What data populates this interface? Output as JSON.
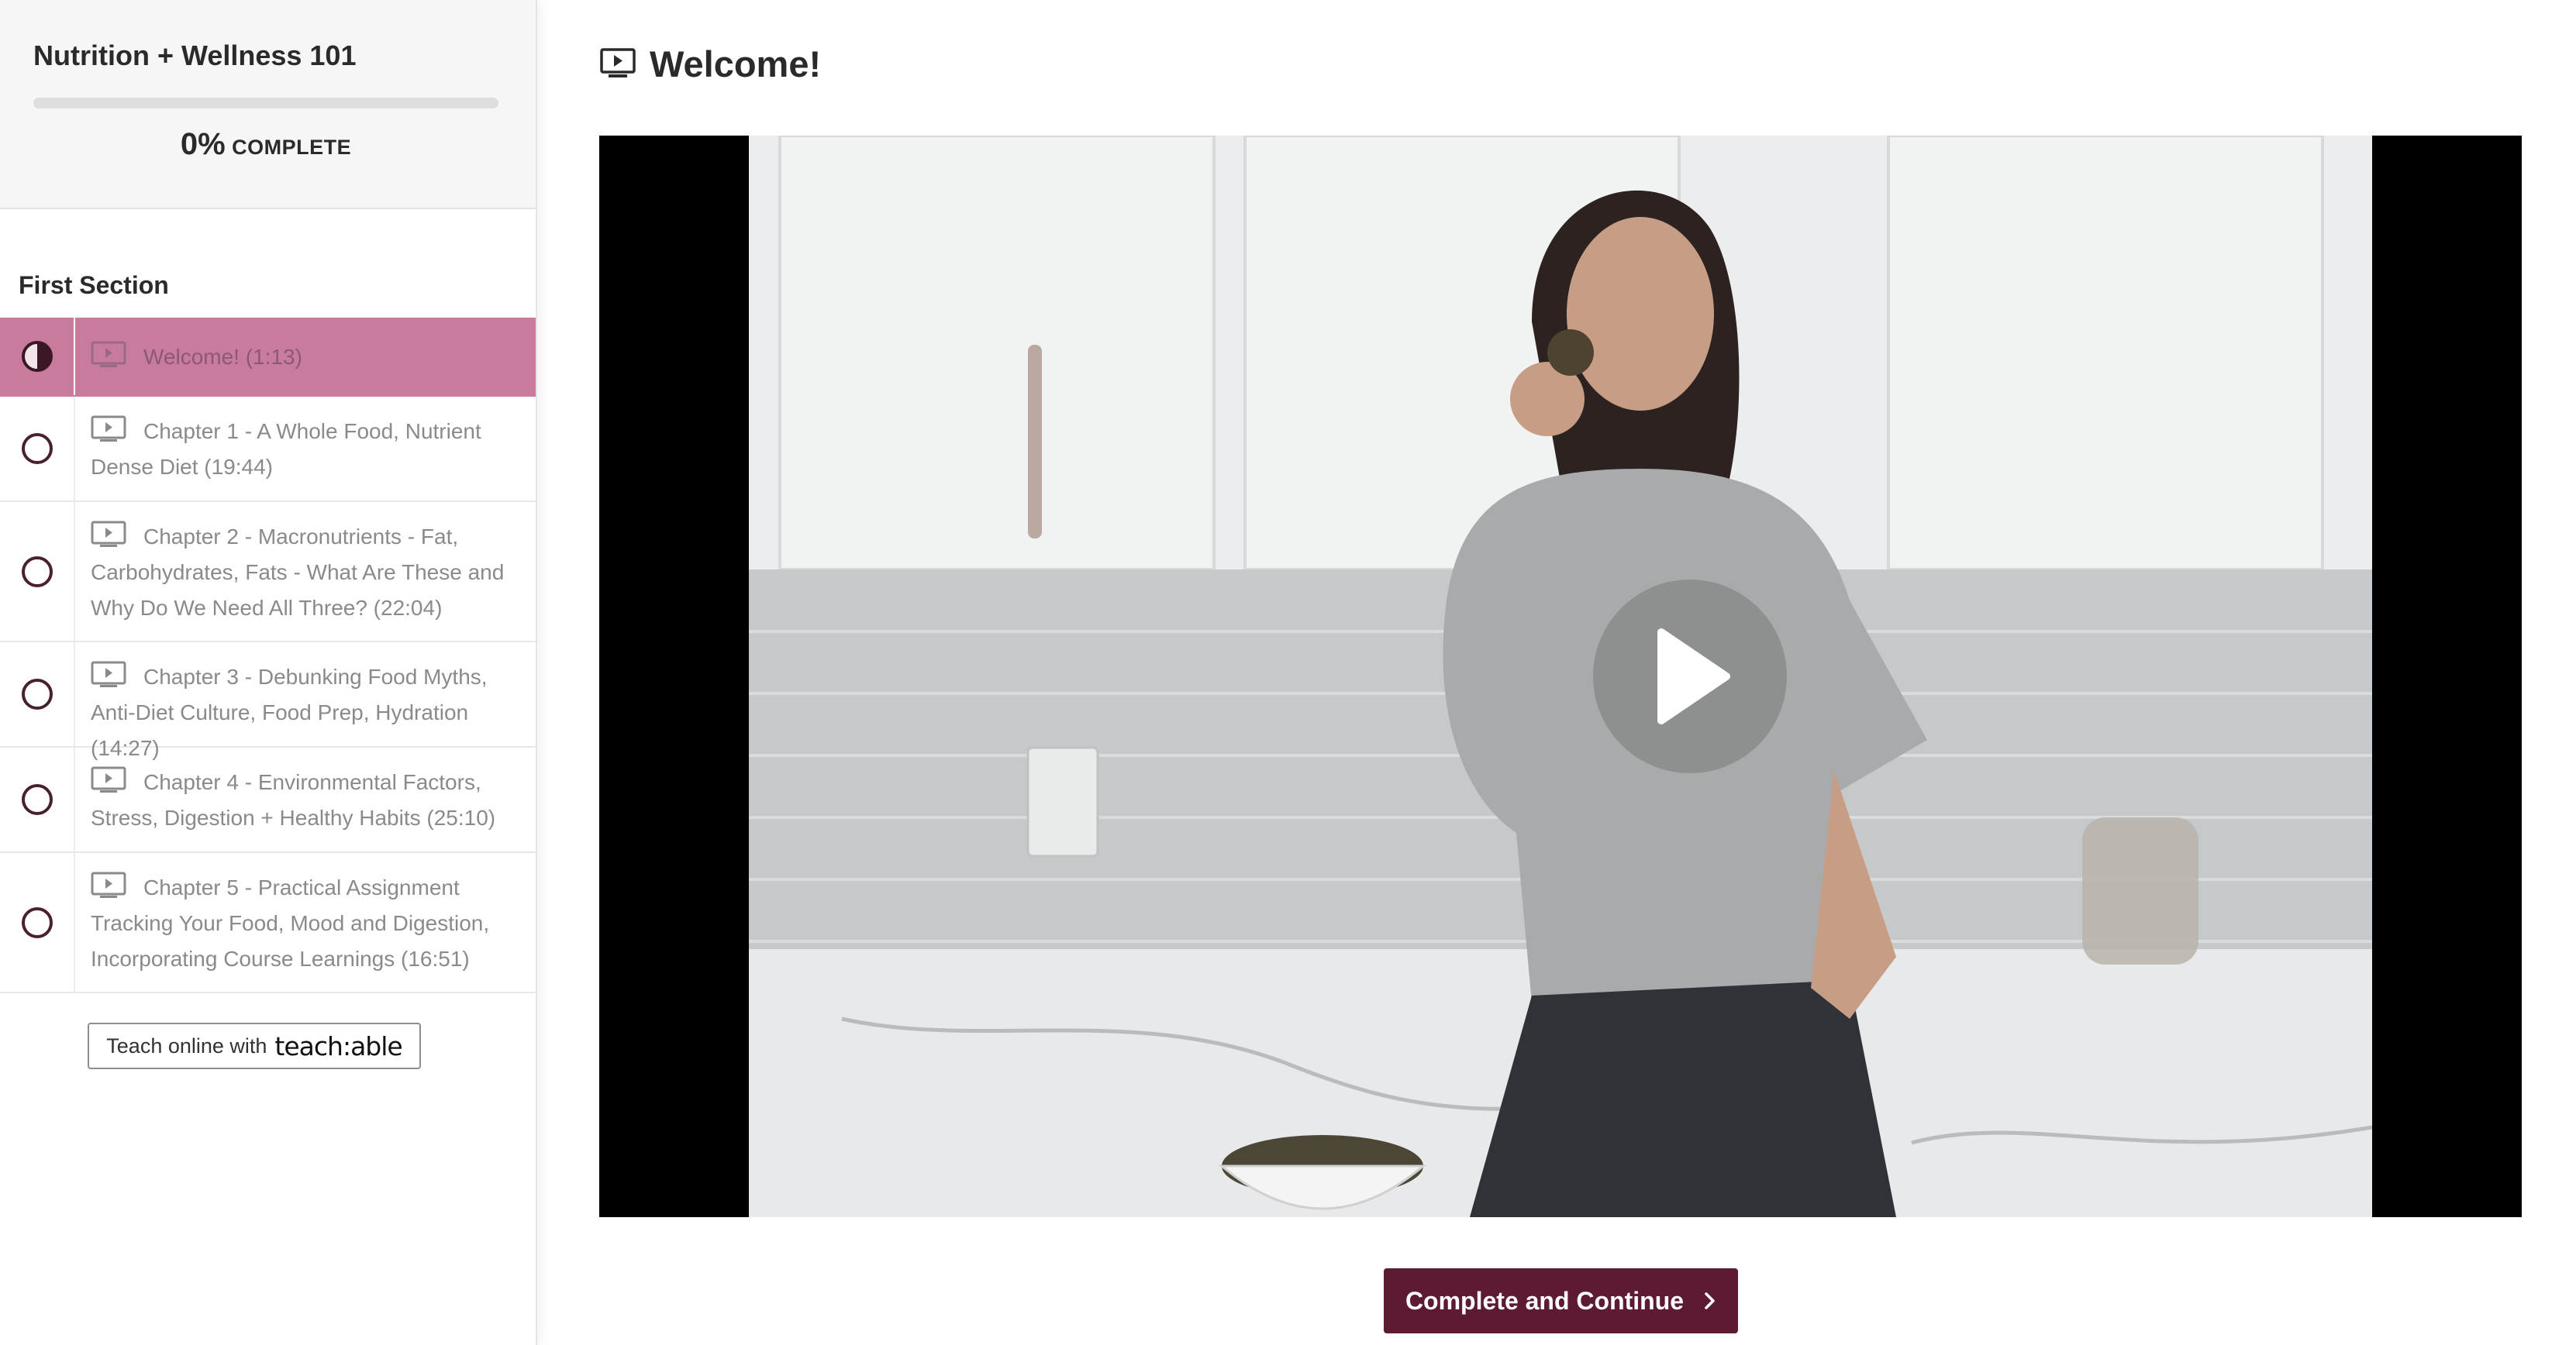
{
  "sidebar": {
    "course_title": "Nutrition + Wellness 101",
    "progress": {
      "percent_value": 0,
      "percent_text": "0%",
      "label": "COMPLETE"
    },
    "section_title": "First Section",
    "lectures": [
      {
        "title": "Welcome! (1:13)",
        "status": "in-progress",
        "active": true
      },
      {
        "title": "Chapter 1 - A Whole Food, Nutrient Dense Diet (19:44)",
        "status": "not-started",
        "active": false
      },
      {
        "title": "Chapter 2 - Macronutrients - Fat, Carbohydrates, Fats - What Are These and Why Do We Need All Three? (22:04)",
        "status": "not-started",
        "active": false
      },
      {
        "title": "Chapter 3 - Debunking Food Myths, Anti-Diet Culture, Food Prep, Hydration (14:27)",
        "status": "not-started",
        "active": false
      },
      {
        "title": "Chapter 4 - Environmental Factors, Stress, Digestion + Healthy Habits (25:10)",
        "status": "not-started",
        "active": false
      },
      {
        "title": "Chapter 5 - Practical Assignment Tracking Your Food, Mood and Digestion, Incorporating Course Learnings (16:51)",
        "status": "not-started",
        "active": false
      }
    ],
    "powered_by": {
      "label": "Teach online with",
      "brand": "teach:able"
    }
  },
  "main": {
    "lecture_title": "Welcome!",
    "video": {
      "state": "paused",
      "play_icon": "play-icon"
    },
    "complete_button_label": "Complete and Continue"
  },
  "colors": {
    "brand": "#5c1a35",
    "active_item": "#c97b9e",
    "sidebar_header_bg": "#f6f6f6",
    "progress_track": "#dedede"
  },
  "icons": {
    "lecture_type": "video-lecture-icon",
    "status_in_progress": "half-circle-icon",
    "status_not_started": "empty-circle-icon",
    "button_chevron": "chevron-right-icon"
  }
}
